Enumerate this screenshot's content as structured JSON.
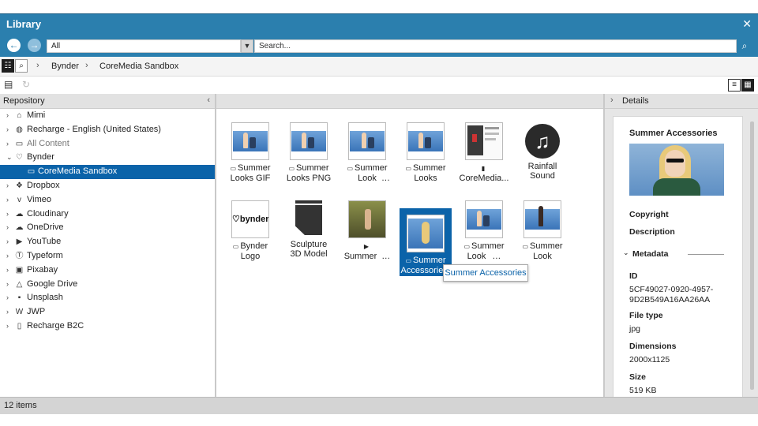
{
  "window": {
    "title": "Library"
  },
  "search": {
    "scope": "All",
    "placeholder": "Search..."
  },
  "breadcrumb": [
    "Bynder",
    "CoreMedia Sandbox"
  ],
  "repository": {
    "header": "Repository",
    "items": [
      {
        "label": "Mimi",
        "icon": "home-icon"
      },
      {
        "label": "Recharge - English (United States)",
        "icon": "globe-icon"
      },
      {
        "label": "All Content",
        "icon": "folder-icon"
      },
      {
        "label": "Bynder",
        "icon": "bynder-icon"
      },
      {
        "label": "CoreMedia Sandbox",
        "icon": "folder-icon"
      },
      {
        "label": "Dropbox",
        "icon": "dropbox-icon"
      },
      {
        "label": "Vimeo",
        "icon": "vimeo-icon"
      },
      {
        "label": "Cloudinary",
        "icon": "cloudinary-icon"
      },
      {
        "label": "OneDrive",
        "icon": "cloud-icon"
      },
      {
        "label": "YouTube",
        "icon": "youtube-icon"
      },
      {
        "label": "Typeform",
        "icon": "typeform-icon"
      },
      {
        "label": "Pixabay",
        "icon": "pixabay-icon"
      },
      {
        "label": "Google Drive",
        "icon": "google-drive-icon"
      },
      {
        "label": "Unsplash",
        "icon": "unsplash-icon"
      },
      {
        "label": "JWP",
        "icon": "jwp-icon"
      },
      {
        "label": "Recharge B2C",
        "icon": "document-icon"
      }
    ]
  },
  "items": [
    {
      "line1": "Summer",
      "line2": "Looks GIF",
      "type": "image"
    },
    {
      "line1": "Summer",
      "line2": "Looks PNG",
      "type": "image"
    },
    {
      "line1": "Summer",
      "line2": "Look",
      "type": "image"
    },
    {
      "line1": "Summer",
      "line2": "Looks",
      "type": "image"
    },
    {
      "line1": "",
      "line2": "CoreMedia...",
      "type": "document"
    },
    {
      "line1": "Rainfall",
      "line2": "Sound",
      "type": "audio"
    },
    {
      "line1": "Bynder",
      "line2": "Logo",
      "type": "logo"
    },
    {
      "line1": "Sculpture",
      "line2": "3D Model",
      "type": "model"
    },
    {
      "line1": "",
      "line2": "Summer",
      "type": "video"
    },
    {
      "line1": "Summer",
      "line2": "Accessorie...",
      "type": "image"
    },
    {
      "line1": "Summer",
      "line2": "Look",
      "type": "image"
    },
    {
      "line1": "Summer",
      "line2": "Look",
      "type": "image"
    }
  ],
  "logo_text": "bynder",
  "tooltip": "Summer Accessories",
  "details": {
    "header": "Details",
    "title": "Summer Accessories",
    "copyright_label": "Copyright",
    "description_label": "Description",
    "metadata_label": "Metadata",
    "id_label": "ID",
    "id_value_1": "5CF49027-0920-4957-",
    "id_value_2": "9D2B549A16AA26AA",
    "filetype_label": "File type",
    "filetype_value": "jpg",
    "dimensions_label": "Dimensions",
    "dimensions_value": "2000x1125",
    "size_label": "Size",
    "size_value": "519 KB"
  },
  "status": {
    "count": "12 items"
  }
}
